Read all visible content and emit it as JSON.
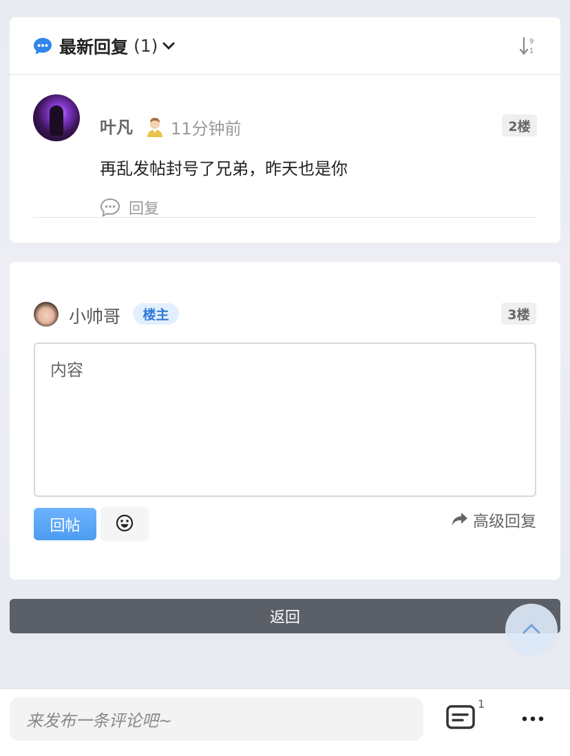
{
  "replies": {
    "title": "最新回复",
    "count": "(1)",
    "items": [
      {
        "author": "叶凡",
        "time": "11分钟前",
        "floor": "2楼",
        "content": "再乱发帖封号了兄弟，昨天也是你",
        "reply_label": "回复"
      }
    ]
  },
  "compose": {
    "username": "小帅哥",
    "owner_badge": "楼主",
    "floor": "3楼",
    "placeholder": "内容",
    "post_label": "回帖",
    "advanced_label": "高级回复"
  },
  "back_label": "返回",
  "bottom": {
    "comment_placeholder": "来发布一条评论吧~",
    "comment_count": "1"
  },
  "icons": {
    "header": "chat-bubble-icon",
    "sort": "sort-numeric-desc-icon",
    "reply": "comment-icon",
    "emoji": "smiley-icon",
    "advanced": "share-arrow-icon",
    "scroll_top": "chevron-up-icon",
    "comments": "comment-box-icon",
    "more": "ellipsis-icon"
  },
  "colors": {
    "accent_blue": "#4d9cf0",
    "owner_badge_bg": "#e3effd",
    "back_bar": "#5b5f68"
  }
}
